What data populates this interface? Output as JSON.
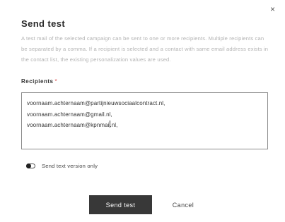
{
  "dialog": {
    "close_glyph": "×",
    "title": "Send test",
    "description": "A test mail of the selected campaign can be sent to one or more recipients. Multiple recipients can be separated by a comma. If a recipient is selected and a contact with same email address exists in the contact list, the existing personalization values are used."
  },
  "recipients": {
    "label": "Recipients",
    "required_marker": "*",
    "lines": [
      "voornaam.achternaam@partijnieuwsociaalcontract.nl,",
      "voornaam.achternaam@gmail.nl,"
    ],
    "last_line_before_caret": "voornaam.achternaam@kpnmail",
    "last_line_after_caret": ".nl,"
  },
  "options": {
    "text_version_label": "Send text version only",
    "text_version_enabled": false
  },
  "actions": {
    "send_label": "Send test",
    "cancel_label": "Cancel"
  },
  "colors": {
    "primary_button": "#383838",
    "required": "#d94a4a",
    "muted_text": "#b3b3b3"
  }
}
